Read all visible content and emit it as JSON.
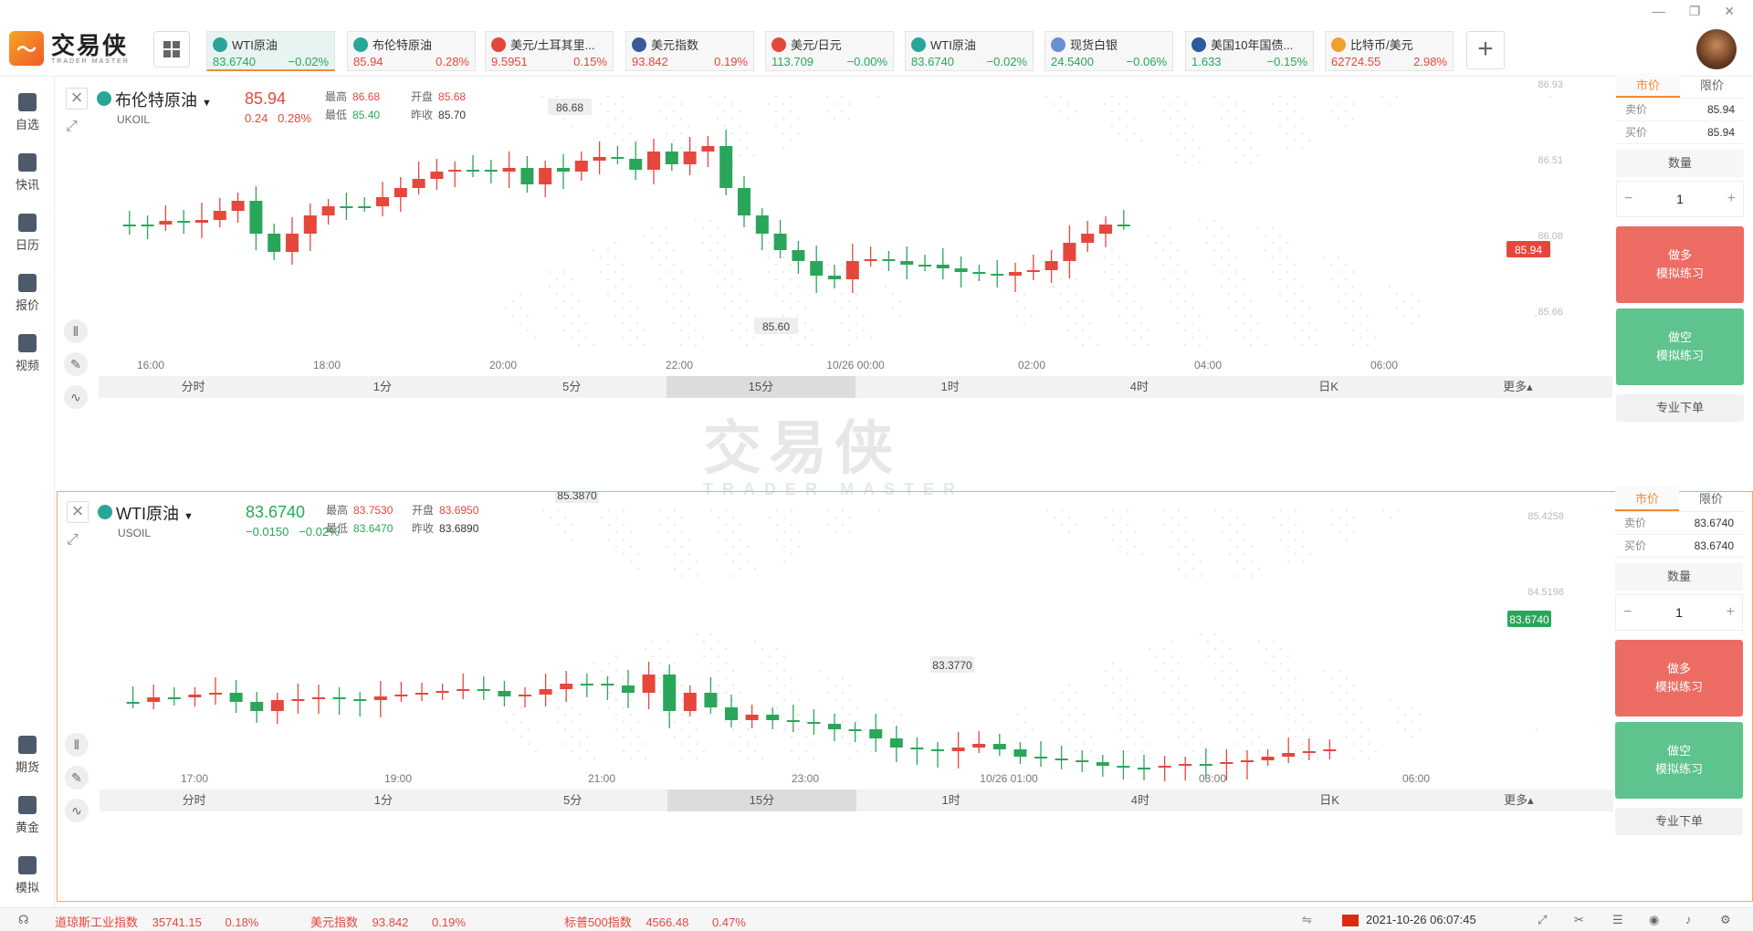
{
  "logo": {
    "cn": "交易侠",
    "en": "TRADER MASTER"
  },
  "tabs": [
    {
      "icon": "oil-icon",
      "name": "WTI原油",
      "price": "83.6740",
      "change": "−0.02%",
      "dir": "down",
      "color": "#2aa59a"
    },
    {
      "icon": "oil-icon",
      "name": "布伦特原油",
      "price": "85.94",
      "change": "0.28%",
      "dir": "up",
      "color": "#2aa59a"
    },
    {
      "icon": "flag-tr-icon",
      "name": "美元/土耳其里...",
      "price": "9.5951",
      "change": "0.15%",
      "dir": "up",
      "color": "#e5473d"
    },
    {
      "icon": "flag-us-icon",
      "name": "美元指数",
      "price": "93.842",
      "change": "0.19%",
      "dir": "up",
      "color": "#3b5998"
    },
    {
      "icon": "flag-jp-icon",
      "name": "美元/日元",
      "price": "113.709",
      "change": "−0.00%",
      "dir": "down",
      "color": "#e5473d"
    },
    {
      "icon": "oil-icon",
      "name": "WTI原油",
      "price": "83.6740",
      "change": "−0.02%",
      "dir": "down",
      "color": "#2aa59a"
    },
    {
      "icon": "silver-icon",
      "name": "现货白银",
      "price": "24.5400",
      "change": "−0.06%",
      "dir": "down",
      "color": "#6a8fd0"
    },
    {
      "icon": "bond-icon",
      "name": "美国10年国债...",
      "price": "1.633",
      "change": "−0.15%",
      "dir": "down",
      "color": "#2d5aa0"
    },
    {
      "icon": "bitcoin-icon",
      "name": "比特币/美元",
      "price": "62724.55",
      "change": "2.98%",
      "dir": "up",
      "color": "#f0a030"
    }
  ],
  "sidebar": [
    {
      "label": "自选",
      "icon": "star-icon"
    },
    {
      "label": "快讯",
      "icon": "news-icon"
    },
    {
      "label": "日历",
      "icon": "calendar-icon"
    },
    {
      "label": "报价",
      "icon": "quote-icon"
    },
    {
      "label": "视频",
      "icon": "video-icon"
    },
    {
      "label": "期货",
      "icon": "futures-icon"
    },
    {
      "label": "黄金",
      "icon": "gold-icon"
    },
    {
      "label": "模拟",
      "icon": "simulate-icon"
    }
  ],
  "panels": [
    {
      "name": "布伦特原油",
      "code": "UKOIL",
      "price": "85.94",
      "change": "0.24",
      "change_pct": "0.28%",
      "dir": "up",
      "high": "86.68",
      "open": "85.68",
      "low": "85.40",
      "prev_close": "85.70",
      "labels": {
        "high": "最高",
        "open": "开盘",
        "low": "最低",
        "prev": "昨收"
      },
      "y_ticks": [
        "86.93",
        "86.51",
        "86.08",
        "85.66"
      ],
      "x_ticks": [
        "16:00",
        "18:00",
        "20:00",
        "22:00",
        "10/26 00:00",
        "02:00",
        "04:00",
        "06:00"
      ],
      "max_label": "86.68",
      "min_label": "85.60",
      "last_label": "85.94",
      "trade": {
        "tab_market": "市价",
        "tab_limit": "限价",
        "sell_label": "卖价",
        "sell": "85.94",
        "buy_label": "买价",
        "buy": "85.94",
        "qty_label": "数量",
        "qty": "1",
        "long": "做多",
        "long_sub": "模拟练习",
        "short": "做空",
        "short_sub": "模拟练习",
        "pro": "专业下单"
      }
    },
    {
      "name": "WTI原油",
      "code": "USOIL",
      "price": "83.6740",
      "change": "−0.0150",
      "change_pct": "−0.02%",
      "dir": "down",
      "high": "83.7530",
      "open": "83.6950",
      "low": "83.6470",
      "prev_close": "83.6890",
      "labels": {
        "high": "最高",
        "open": "开盘",
        "low": "最低",
        "prev": "昨收"
      },
      "y_ticks": [
        "85.4258",
        "84.5196"
      ],
      "x_ticks": [
        "17:00",
        "19:00",
        "21:00",
        "23:00",
        "10/26 01:00",
        "03:00",
        "06:00"
      ],
      "max_label": "85.3870",
      "min_label": "83.3770",
      "last_label": "83.6740",
      "trade": {
        "tab_market": "市价",
        "tab_limit": "限价",
        "sell_label": "卖价",
        "sell": "83.6740",
        "buy_label": "买价",
        "buy": "83.6740",
        "qty_label": "数量",
        "qty": "1",
        "long": "做多",
        "long_sub": "模拟练习",
        "short": "做空",
        "short_sub": "模拟练习",
        "pro": "专业下单"
      }
    }
  ],
  "periods": [
    "分时",
    "1分",
    "5分",
    "15分",
    "1时",
    "4时",
    "日K",
    "更多▴"
  ],
  "active_period": "15分",
  "watermark": {
    "cn": "交易侠",
    "en": "TRADER MASTER"
  },
  "status": {
    "items": [
      {
        "name": "道琼斯工业指数",
        "value": "35741.15",
        "pct": "0.18%"
      },
      {
        "name": "美元指数",
        "value": "93.842",
        "pct": "0.19%"
      },
      {
        "name": "标普500指数",
        "value": "4566.48",
        "pct": "0.47%"
      }
    ],
    "datetime": "2021-10-26 06:07:45"
  },
  "colors": {
    "up": "#e5473d",
    "down": "#2aa65a",
    "accent": "#ef8c3b"
  }
}
